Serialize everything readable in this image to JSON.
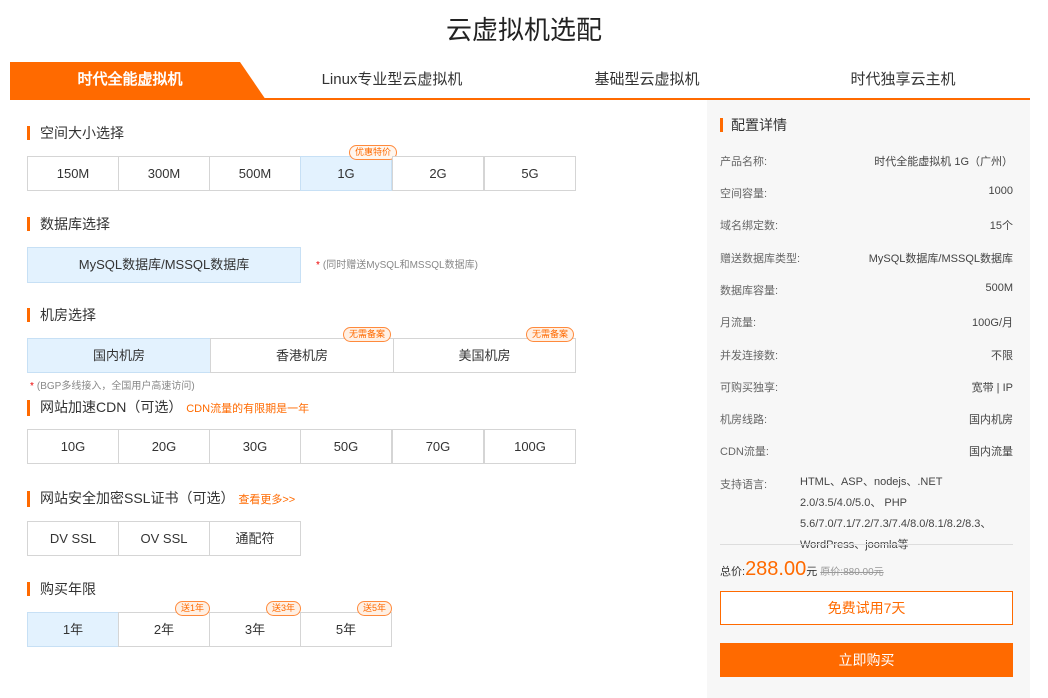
{
  "page": {
    "title": "云虚拟机选配"
  },
  "tabs": [
    {
      "label": "时代全能虚拟机",
      "active": true
    },
    {
      "label": "Linux专业型云虚拟机",
      "active": false
    },
    {
      "label": "基础型云虚拟机",
      "active": false
    },
    {
      "label": "时代独享云主机",
      "active": false
    }
  ],
  "colors": {
    "accent": "#ff6a00",
    "selected_bg": "#e3f2fe",
    "panel_bg": "#f7f7f7"
  },
  "space": {
    "title": "空间大小选择",
    "options": [
      "150M",
      "300M",
      "500M",
      "1G",
      "2G",
      "5G"
    ],
    "selected": "1G",
    "badge": "优惠特价"
  },
  "database": {
    "title": "数据库选择",
    "option": "MySQL数据库/MSSQL数据库",
    "note": "(同时赠送MySQL和MSSQL数据库)",
    "note_star": "*"
  },
  "datacenter": {
    "title": "机房选择",
    "options": [
      "国内机房",
      "香港机房",
      "美国机房"
    ],
    "selected": "国内机房",
    "badge": "无需备案",
    "note": "(BGP多线接入，全国用户高速访问)",
    "note_star": "*"
  },
  "cdn": {
    "title": "网站加速CDN（可选）",
    "note": "CDN流量的有限期是一年",
    "options": [
      "10G",
      "20G",
      "30G",
      "50G",
      "70G",
      "100G"
    ]
  },
  "ssl": {
    "title": "网站安全加密SSL证书（可选）",
    "more": "查看更多>>",
    "options": [
      "DV SSL",
      "OV SSL",
      "通配符"
    ]
  },
  "period": {
    "title": "购买年限",
    "options": [
      "1年",
      "2年",
      "3年",
      "5年"
    ],
    "selected": "1年",
    "badges": [
      "",
      "送1年",
      "送3年",
      "送5年"
    ]
  },
  "details": {
    "title": "配置详情",
    "rows": [
      {
        "k": "产品名称:",
        "v": "时代全能虚拟机 1G（广州）"
      },
      {
        "k": "空间容量:",
        "v": "1000"
      },
      {
        "k": "域名绑定数:",
        "v": "15个"
      },
      {
        "k": "赠送数据库类型:",
        "v": "MySQL数据库/MSSQL数据库"
      },
      {
        "k": "数据库容量:",
        "v": "500M"
      },
      {
        "k": "月流量:",
        "v": "100G/月"
      },
      {
        "k": "并发连接数:",
        "v": "不限"
      },
      {
        "k": "可购买独享:",
        "v": "宽带 | IP"
      },
      {
        "k": "机房线路:",
        "v": "国内机房"
      },
      {
        "k": "CDN流量:",
        "v": "国内流量"
      }
    ],
    "lang_label": "支持语言:",
    "lang_value": "HTML、ASP、nodejs、.NET 2.0/3.5/4.0/5.0、 PHP 5.6/7.0/7.1/7.2/7.3/7.4/8.0/8.1/8.2/8.3、 WordPress、joomla等",
    "total_label": "总价:",
    "price": "288.00",
    "unit": "元",
    "orig_label": "原价:",
    "orig_price": "880.00元",
    "trial_button": "免费试用7天",
    "buy_button": "立即购买"
  }
}
